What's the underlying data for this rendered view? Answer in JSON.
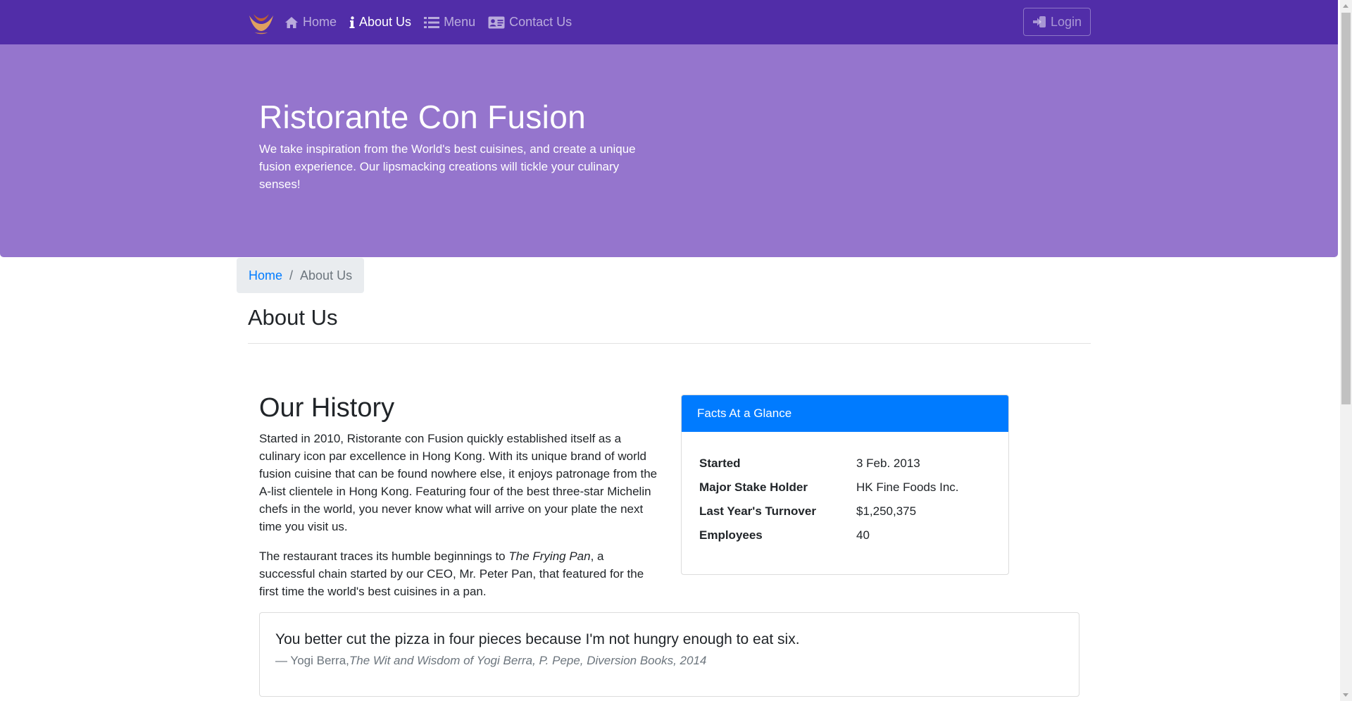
{
  "navbar": {
    "brand_icon": "logo-icon",
    "items": [
      {
        "label": "Home",
        "icon": "home-icon",
        "active": false
      },
      {
        "label": "About Us",
        "icon": "info-icon",
        "active": true
      },
      {
        "label": "Menu",
        "icon": "list-icon",
        "active": false
      },
      {
        "label": "Contact Us",
        "icon": "address-card-icon",
        "active": false
      }
    ],
    "login_label": "Login",
    "login_icon": "sign-in-icon",
    "colors": {
      "background": "#512da8"
    }
  },
  "jumbotron": {
    "title": "Ristorante Con Fusion",
    "text": "We take inspiration from the World's best cuisines, and create a unique fusion experience. Our lipsmacking creations will tickle your culinary senses!",
    "colors": {
      "background": "#9575cd"
    }
  },
  "breadcrumb": {
    "home": "Home",
    "separator": "/",
    "current": "About Us"
  },
  "page": {
    "title": "About Us"
  },
  "history": {
    "title": "Our History",
    "paragraph1": "Started in 2010, Ristorante con Fusion quickly established itself as a culinary icon par excellence in Hong Kong. With its unique brand of world fusion cuisine that can be found nowhere else, it enjoys patronage from the A-list clientele in Hong Kong. Featuring four of the best three-star Michelin chefs in the world, you never know what will arrive on your plate the next time you visit us.",
    "paragraph2_before": "The restaurant traces its humble beginnings to ",
    "paragraph2_em": "The Frying Pan",
    "paragraph2_after": ", a successful chain started by our CEO, Mr. Peter Pan, that featured for the first time the world's best cuisines in a pan."
  },
  "facts": {
    "header": "Facts At a Glance",
    "rows": [
      {
        "label": "Started",
        "value": "3 Feb. 2013"
      },
      {
        "label": "Major Stake Holder",
        "value": "HK Fine Foods Inc."
      },
      {
        "label": "Last Year's Turnover",
        "value": "$1,250,375"
      },
      {
        "label": "Employees",
        "value": "40"
      }
    ],
    "colors": {
      "header": "#007bff"
    }
  },
  "quote": {
    "text": "You better cut the pizza in four pieces because I'm not hungry enough to eat six.",
    "author": "— Yogi Berra,",
    "source": "The Wit and Wisdom of Yogi Berra, P. Pepe, Diversion Books, 2014"
  }
}
